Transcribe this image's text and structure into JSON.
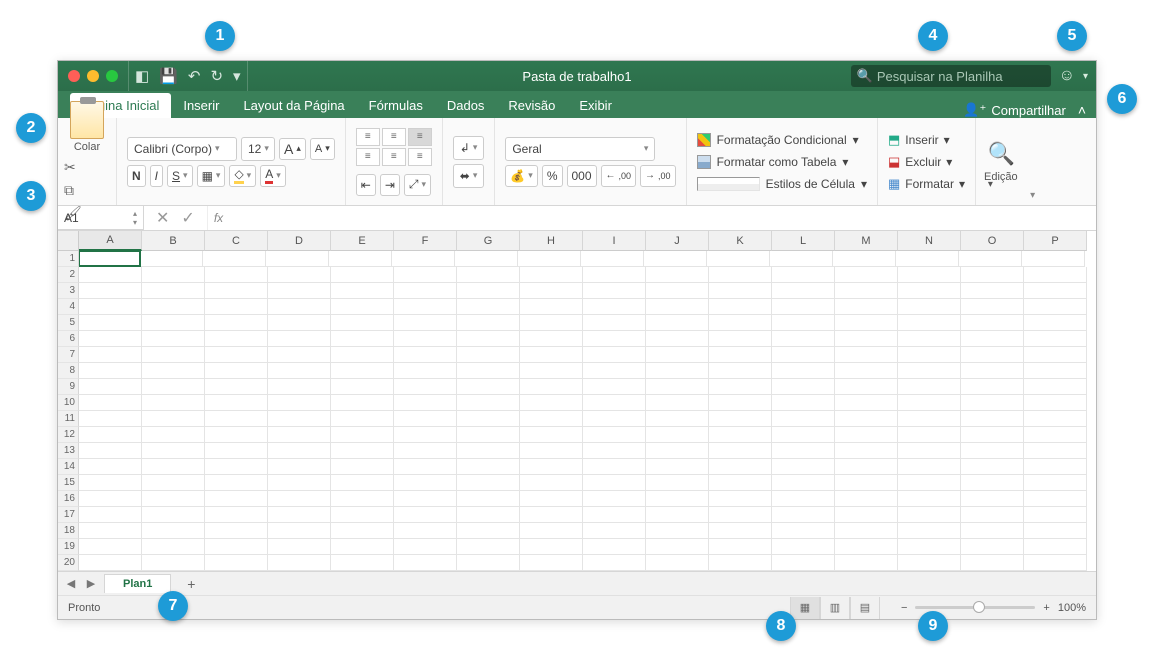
{
  "window": {
    "title": "Pasta de trabalho1",
    "search_placeholder": "Pesquisar na Planilha"
  },
  "tabs": {
    "items": [
      "Página Inicial",
      "Inserir",
      "Layout da Página",
      "Fórmulas",
      "Dados",
      "Revisão",
      "Exibir"
    ],
    "active_index": 0,
    "share_label": "Compartilhar"
  },
  "ribbon": {
    "paste_label": "Colar",
    "font_name": "Calibri (Corpo)",
    "font_size": "12",
    "bold": "N",
    "italic": "I",
    "underline": "S",
    "increase_font": "A",
    "decrease_font": "A",
    "number_format": "Geral",
    "thousands": "000",
    "inc_dec": ",00",
    "dec_dec": ",00",
    "cond_fmt": "Formatação Condicional",
    "as_table": "Formatar como Tabela",
    "cell_styles": "Estilos de Célula",
    "insert": "Inserir",
    "delete": "Excluir",
    "format": "Formatar",
    "editing": "Edição"
  },
  "formula_bar": {
    "namebox": "A1",
    "fx": "fx"
  },
  "sheet": {
    "columns": [
      "A",
      "B",
      "C",
      "D",
      "E",
      "F",
      "G",
      "H",
      "I",
      "J",
      "K",
      "L",
      "M",
      "N",
      "O",
      "P"
    ],
    "rows": [
      "1",
      "2",
      "3",
      "4",
      "5",
      "6",
      "7",
      "8",
      "9",
      "10",
      "11",
      "12",
      "13",
      "14",
      "15",
      "16",
      "17",
      "18",
      "19",
      "20"
    ],
    "tab_name": "Plan1"
  },
  "status": {
    "ready": "Pronto",
    "zoom": "100%"
  },
  "callouts": {
    "c1": "1",
    "c2": "2",
    "c3": "3",
    "c4": "4",
    "c5": "5",
    "c6": "6",
    "c7": "7",
    "c8": "8",
    "c9": "9"
  }
}
